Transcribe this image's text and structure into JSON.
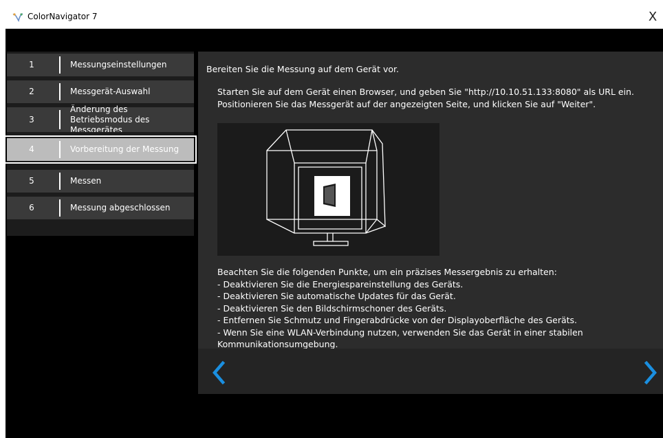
{
  "window": {
    "title": "ColorNavigator 7",
    "close_glyph": "X"
  },
  "steps": [
    {
      "num": "1",
      "label": "Messungseinstellungen"
    },
    {
      "num": "2",
      "label": "Messgerät-Auswahl"
    },
    {
      "num": "3",
      "label": "Änderung des Betriebsmodus des Messgerätes"
    },
    {
      "num": "4",
      "label": "Vorbereitung der Messung",
      "active": true
    },
    {
      "num": "5",
      "label": "Messen"
    },
    {
      "num": "6",
      "label": "Messung abgeschlossen"
    }
  ],
  "content": {
    "heading": "Bereiten Sie die Messung auf dem Gerät vor.",
    "intro_line1": "Starten Sie auf dem Gerät einen Browser, und geben Sie \"http://10.10.51.133:8080\" als URL ein.",
    "intro_line2": "Positionieren Sie das Messgerät auf der angezeigten Seite, und klicken Sie auf \"Weiter\".",
    "notes": [
      "Beachten Sie die folgenden Punkte, um ein präzises Messergebnis zu erhalten:",
      "- Deaktivieren Sie die Energiespareinstellung des Geräts.",
      "- Deaktivieren Sie automatische Updates für das Gerät.",
      "- Deaktivieren Sie den Bildschirmschoner des Geräts.",
      "- Entfernen Sie Schmutz und Fingerabdrücke von der Displayoberfläche des Geräts.",
      "- Wenn Sie eine WLAN-Verbindung nutzen, verwenden Sie das Gerät in einer stabilen",
      "Kommunikationsumgebung."
    ]
  },
  "nav": {
    "back_icon": "chevron-left-icon",
    "next_icon": "chevron-right-icon"
  },
  "colors": {
    "accent": "#1a8fe0",
    "highlight": "#c8127b"
  }
}
